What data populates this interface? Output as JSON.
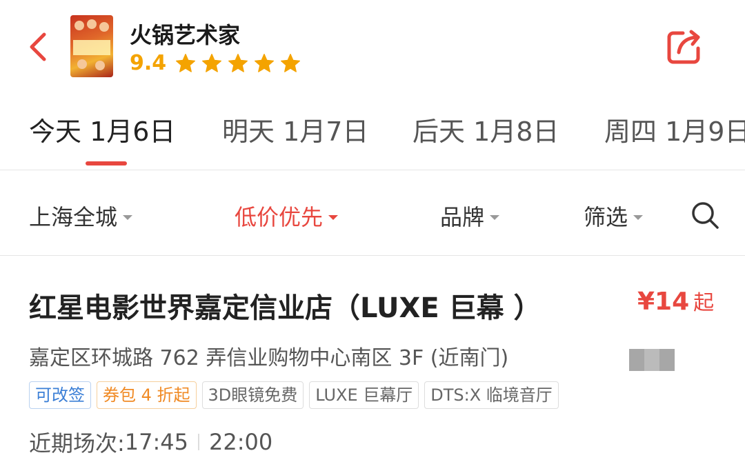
{
  "header": {
    "movie_title": "火锅艺术家",
    "rating": "9.4",
    "stars": 5,
    "accent_color": "#e8473f",
    "star_color": "#f4a300"
  },
  "date_tabs": [
    {
      "label": "今天 1月6日",
      "active": true
    },
    {
      "label": "明天 1月7日",
      "active": false
    },
    {
      "label": "后天 1月8日",
      "active": false
    },
    {
      "label": "周四 1月9日",
      "active": false
    }
  ],
  "filters": [
    {
      "label": "上海全城",
      "active": false
    },
    {
      "label": "低价优先",
      "active": true
    },
    {
      "label": "品牌",
      "active": false
    },
    {
      "label": "筛选",
      "active": false
    }
  ],
  "cinema": {
    "name": "红星电影世界嘉定信业店（LUXE 巨幕 ）",
    "price": "¥14",
    "price_suffix": "起",
    "address": "嘉定区环城路 762 弄信业购物中心南区 3F (近南门)",
    "tags": [
      {
        "label": "可改签",
        "style": "blue"
      },
      {
        "label": "券包 4 折起",
        "style": "orange"
      },
      {
        "label": "3D眼镜免费",
        "style": "gray"
      },
      {
        "label": "LUXE 巨幕厅",
        "style": "gray"
      },
      {
        "label": "DTS:X 临境音厅",
        "style": "gray"
      }
    ],
    "showtimes_label": "近期场次: ",
    "showtimes": [
      "17:45",
      "22:00"
    ]
  }
}
